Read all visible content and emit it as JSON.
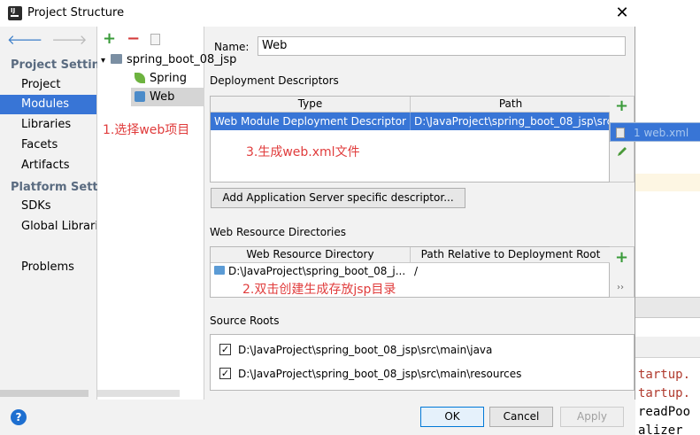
{
  "window": {
    "title": "Project Structure",
    "close": "✕",
    "app_icon": "IJ"
  },
  "nav": {
    "back": "🡐",
    "forward": "🡒",
    "project_settings_header": "Project Settings",
    "project_settings": [
      "Project",
      "Modules",
      "Libraries",
      "Facets",
      "Artifacts"
    ],
    "platform_settings_header": "Platform Settings",
    "platform_settings": [
      "SDKs",
      "Global Libraries"
    ],
    "problems": "Problems",
    "selected": "Modules"
  },
  "tree": {
    "add": "+",
    "remove": "−",
    "nodes": [
      {
        "label": "spring_boot_08_jsp",
        "expander": "▾"
      },
      {
        "label": "Spring"
      },
      {
        "label": "Web"
      }
    ]
  },
  "annotations": {
    "step1": "1.选择web项目",
    "step2": "2.双击创建生成存放jsp目录",
    "step3": "3.生成web.xml文件"
  },
  "facet": {
    "name_label": "Name:",
    "name_value": "Web",
    "deployment_descriptors_title": "Deployment Descriptors",
    "dd_columns": [
      "Type",
      "Path"
    ],
    "dd_rows": [
      {
        "type": "Web Module Deployment Descriptor",
        "path": "D:\\JavaProject\\spring_boot_08_jsp\\src"
      }
    ],
    "popup_item": "1  web.xml",
    "add_server_button": "Add Application Server specific descriptor...",
    "web_resource_title": "Web Resource Directories",
    "wr_columns": [
      "Web Resource Directory",
      "Path Relative to Deployment Root"
    ],
    "wr_rows": [
      {
        "dir": "D:\\JavaProject\\spring_boot_08_j...",
        "rel": "/"
      }
    ],
    "more": "››",
    "source_roots_title": "Source Roots",
    "source_roots": [
      {
        "checked": "✓",
        "path": "D:\\JavaProject\\spring_boot_08_jsp\\src\\main\\java"
      },
      {
        "checked": "✓",
        "path": "D:\\JavaProject\\spring_boot_08_jsp\\src\\main\\resources"
      }
    ]
  },
  "buttons": {
    "ok": "OK",
    "cancel": "Cancel",
    "apply": "Apply",
    "help": "?"
  },
  "background_console": [
    "tartup.",
    "tartup.",
    "readPoo",
    "alizer"
  ]
}
